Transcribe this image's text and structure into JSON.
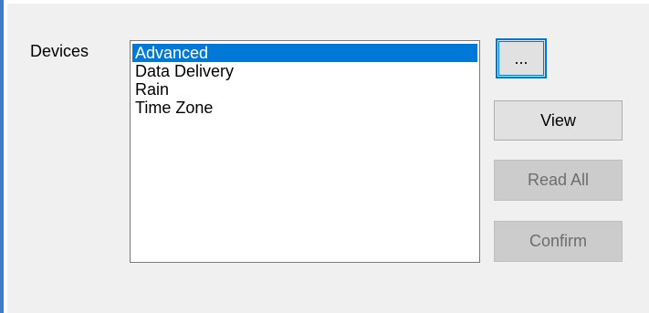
{
  "devices_group": {
    "label": "Devices",
    "list_items": [
      {
        "label": "Advanced",
        "selected": true
      },
      {
        "label": "Data Delivery",
        "selected": false
      },
      {
        "label": "Rain",
        "selected": false
      },
      {
        "label": "Time Zone",
        "selected": false
      }
    ]
  },
  "buttons": {
    "browse": "...",
    "view": "View",
    "read_all": "Read All",
    "confirm": "Confirm"
  },
  "colors": {
    "selection": "#0078d7",
    "window_frame": "#3c7fc6",
    "disabled_button": "#cccccc"
  }
}
